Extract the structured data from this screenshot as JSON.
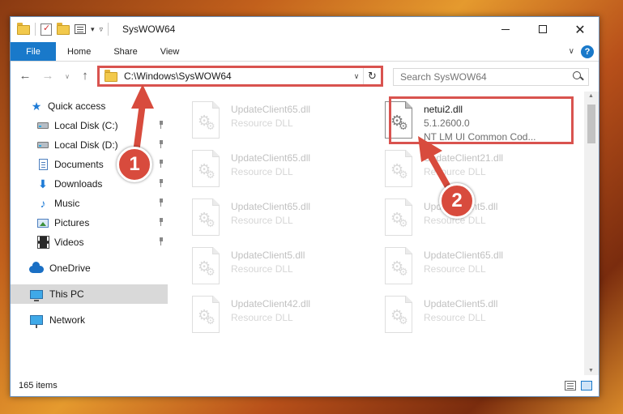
{
  "window": {
    "title": "SysWOW64"
  },
  "ribbon": {
    "tabs": [
      {
        "label": "File"
      },
      {
        "label": "Home"
      },
      {
        "label": "Share"
      },
      {
        "label": "View"
      }
    ],
    "help_label": "?"
  },
  "address": {
    "path": "C:\\Windows\\SysWOW64"
  },
  "search": {
    "placeholder": "Search SysWOW64"
  },
  "navigation": {
    "items": [
      {
        "label": "Quick access",
        "icon": "star-icon"
      },
      {
        "label": "Local Disk (C:)",
        "icon": "disk-icon",
        "pinned": true
      },
      {
        "label": "Local Disk (D:)",
        "icon": "disk-icon",
        "pinned": true
      },
      {
        "label": "Documents",
        "icon": "documents-icon",
        "pinned": true
      },
      {
        "label": "Downloads",
        "icon": "downloads-icon",
        "pinned": true
      },
      {
        "label": "Music",
        "icon": "music-icon",
        "pinned": true
      },
      {
        "label": "Pictures",
        "icon": "pictures-icon",
        "pinned": true
      },
      {
        "label": "Videos",
        "icon": "videos-icon",
        "pinned": true
      },
      {
        "label": "OneDrive",
        "icon": "cloud-icon"
      },
      {
        "label": "This PC",
        "icon": "pc-icon",
        "selected": true
      },
      {
        "label": "Network",
        "icon": "network-icon"
      }
    ]
  },
  "files": {
    "highlighted": {
      "name": "netui2.dll",
      "version": "5.1.2600.0",
      "description": "NT LM UI Common Cod..."
    },
    "left_column": [
      {
        "name": "UpdateClient65.dll",
        "type": "Resource DLL"
      },
      {
        "name": "UpdateClient65.dll",
        "type": "Resource DLL"
      },
      {
        "name": "UpdateClient65.dll",
        "type": "Resource DLL"
      },
      {
        "name": "UpdateClient5.dll",
        "type": "Resource DLL"
      },
      {
        "name": "UpdateClient42.dll",
        "type": "Resource DLL"
      }
    ],
    "right_column": [
      {
        "name": "UpdateClient21.dll",
        "type": "Resource DLL"
      },
      {
        "name": "UpdateClient5.dll",
        "type": "Resource DLL"
      },
      {
        "name": "UpdateClient65.dll",
        "type": "Resource DLL"
      },
      {
        "name": "UpdateClient5.dll",
        "type": "Resource DLL"
      }
    ]
  },
  "status": {
    "item_count": "165 items"
  },
  "callouts": [
    {
      "number": "1"
    },
    {
      "number": "2"
    }
  ],
  "colors": {
    "accent": "#1979ca",
    "callout": "#d84b3d",
    "highlight_border": "#d9534f"
  }
}
